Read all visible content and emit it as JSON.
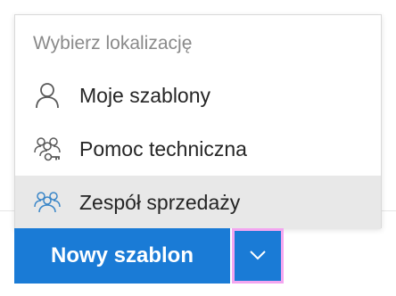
{
  "menu": {
    "header": "Wybierz lokalizację",
    "items": [
      {
        "label": "Moje szablony",
        "icon": "person-icon",
        "active": false
      },
      {
        "label": "Pomoc techniczna",
        "icon": "group-key-icon",
        "active": false
      },
      {
        "label": "Zespół sprzedaży",
        "icon": "group-icon",
        "active": true
      }
    ]
  },
  "button": {
    "main_label": "Nowy szablon",
    "dropdown_icon": "chevron-down-icon"
  },
  "colors": {
    "primary": "#1a7bd6",
    "highlight_border": "#f3a6f0",
    "active_item_bg": "#e8e8e8",
    "group_icon_active": "#3a86c8"
  }
}
